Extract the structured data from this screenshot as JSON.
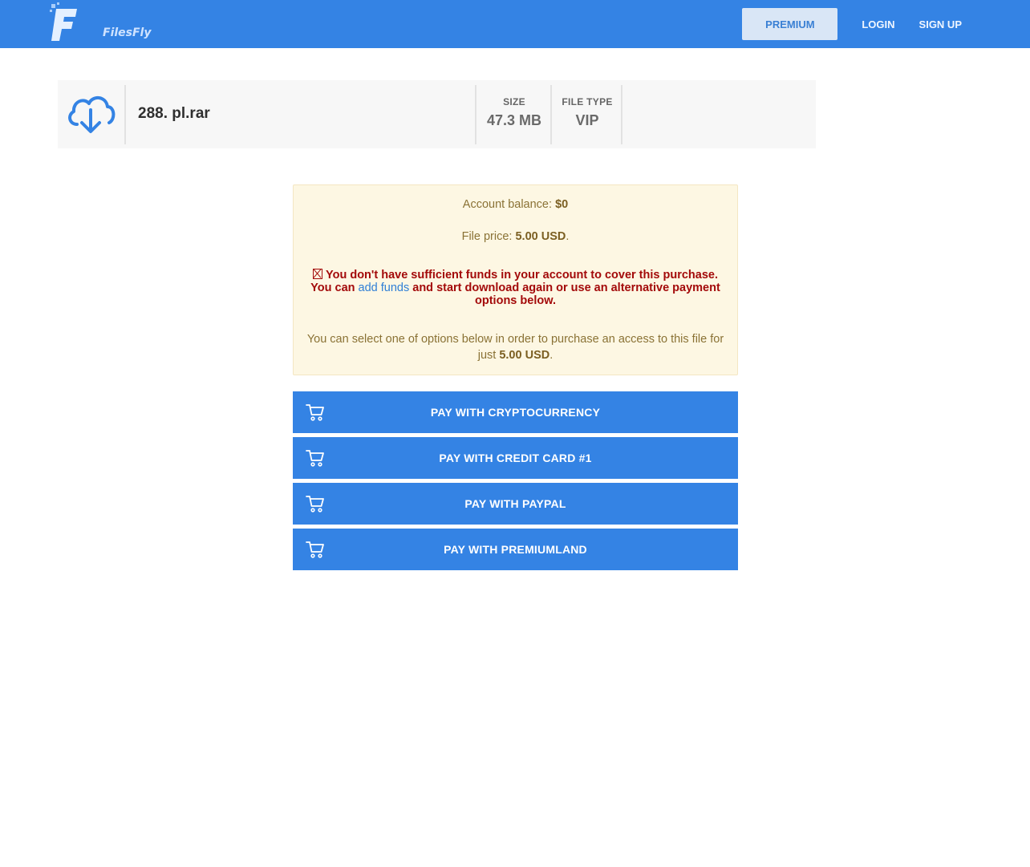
{
  "header": {
    "logo_text": "FilesFly",
    "nav": {
      "premium": "PREMIUM",
      "login": "LOGIN",
      "signup": "SIGN UP"
    }
  },
  "file": {
    "name": "288. pl.rar",
    "size_label": "SIZE",
    "size_value": "47.3 MB",
    "type_label": "FILE TYPE",
    "type_value": "VIP",
    "icon": "cloud-download-icon"
  },
  "alert": {
    "balance_label": "Account balance: ",
    "balance_value": "$0",
    "price_label": "File price: ",
    "price_value": "5.00 USD",
    "period": ".",
    "warning_part1": "You don't have sufficient funds in your account to cover this purchase. You can ",
    "add_funds_link": "add funds",
    "warning_part2": " and start download again or use an alternative payment options below.",
    "options_text": "You can select one of options below in order to purchase an access to this file for just ",
    "options_price": "5.00 USD"
  },
  "payment_buttons": [
    {
      "label": "PAY WITH CRYPTOCURRENCY",
      "icon": "cart-icon"
    },
    {
      "label": "PAY WITH CREDIT CARD #1",
      "icon": "cart-icon"
    },
    {
      "label": "PAY WITH PAYPAL",
      "icon": "cart-icon"
    },
    {
      "label": "PAY WITH PREMIUMLAND",
      "icon": "cart-icon"
    }
  ],
  "colors": {
    "brand_blue": "#3483e4",
    "alert_bg": "#fdf7e3",
    "warning_red": "#a30a0a"
  }
}
